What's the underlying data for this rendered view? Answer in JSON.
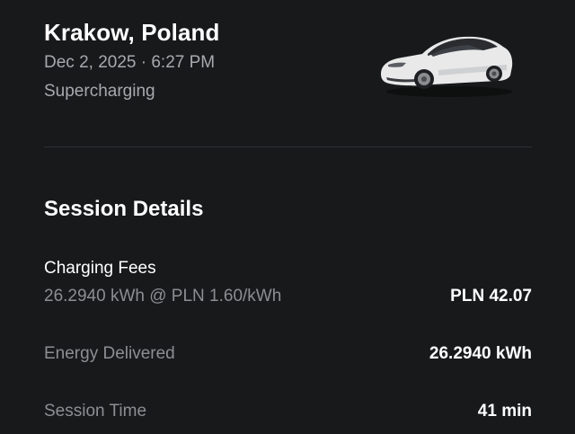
{
  "header": {
    "location": "Krakow, Poland",
    "datetime": "Dec 2, 2025 · 6:27 PM",
    "charge_type": "Supercharging"
  },
  "vehicle": {
    "image": "white-sedan-car-image",
    "color": "#f2f2f2"
  },
  "session": {
    "title": "Session Details",
    "charging_fees": {
      "label": "Charging Fees",
      "rate_text": "26.2940 kWh @ PLN 1.60/kWh",
      "amount": "PLN 42.07"
    },
    "energy_delivered": {
      "label": "Energy Delivered",
      "value": "26.2940 kWh"
    },
    "session_time": {
      "label": "Session Time",
      "value": "41 min"
    }
  },
  "colors": {
    "background": "#18191b",
    "primary_text": "#ffffff",
    "secondary_text": "#a8a9ad",
    "divider": "#2e2f32"
  }
}
